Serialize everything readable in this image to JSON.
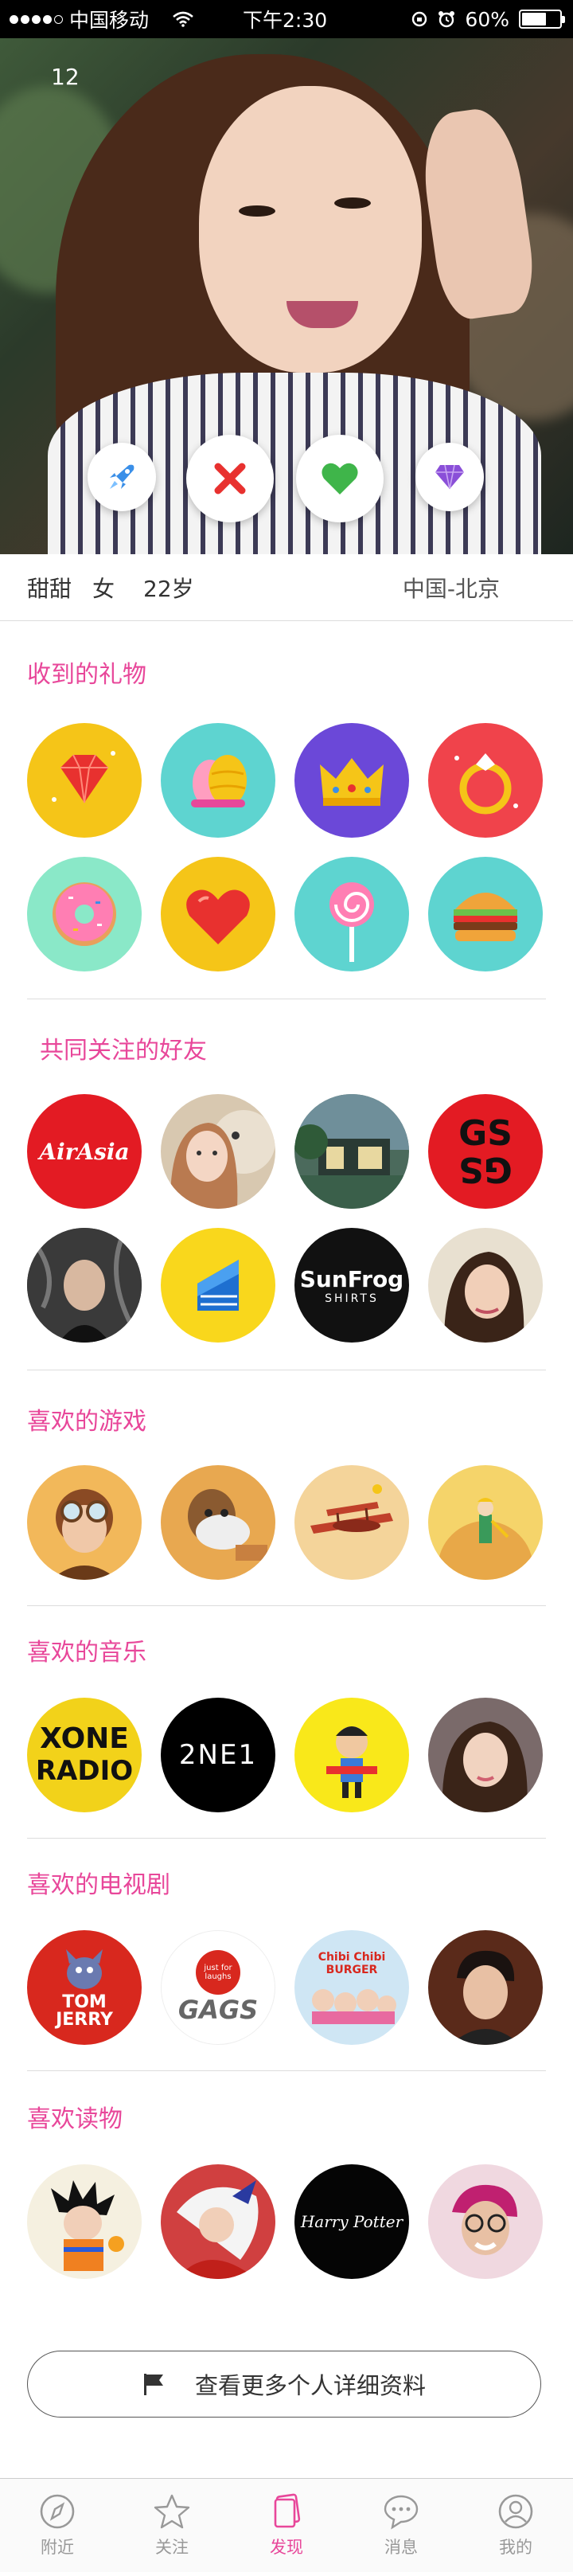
{
  "status_bar": {
    "carrier": "中国移动",
    "time": "下午2:30",
    "battery": "60%"
  },
  "hero": {
    "photo_counter": "12"
  },
  "profile": {
    "name": "甜甜",
    "gender": "女",
    "age": "22岁",
    "location": "中国-北京"
  },
  "sections": {
    "gifts": "收到的礼物",
    "friends": "共同关注的好友",
    "games": "喜欢的游戏",
    "music": "喜欢的音乐",
    "tv": "喜欢的电视剧",
    "reading": "喜欢读物"
  },
  "friends_logos": {
    "airasia": "AirAsia",
    "gs_top": "GS",
    "gs_bottom": "GS",
    "sunfrog_top": "SunFrog",
    "sunfrog_bottom": "SHIRTS"
  },
  "music_logos": {
    "xone_top": "XONE",
    "xone_bottom": "RADIO",
    "twone": "2NE1"
  },
  "tv_logos": {
    "tom_top": "TOM",
    "tom_bottom": "JERRY",
    "gags_small": "just for laughs",
    "gags": "GAGS",
    "chibi": "Chibi Chibi",
    "burger": "BURGER"
  },
  "reading_logos": {
    "hp": "Harry Potter"
  },
  "more_button": "查看更多个人详细资料",
  "tabs": [
    {
      "label": "附近",
      "icon": "compass-icon"
    },
    {
      "label": "关注",
      "icon": "star-icon"
    },
    {
      "label": "发现",
      "icon": "cards-icon",
      "active": true
    },
    {
      "label": "消息",
      "icon": "chat-icon"
    },
    {
      "label": "我的",
      "icon": "user-icon"
    }
  ],
  "colors": {
    "accent": "#e8479a",
    "like": "#3fb54a",
    "dislike": "#e8312f",
    "boost": "#3a8fe8",
    "super": "#8a4fd8"
  }
}
